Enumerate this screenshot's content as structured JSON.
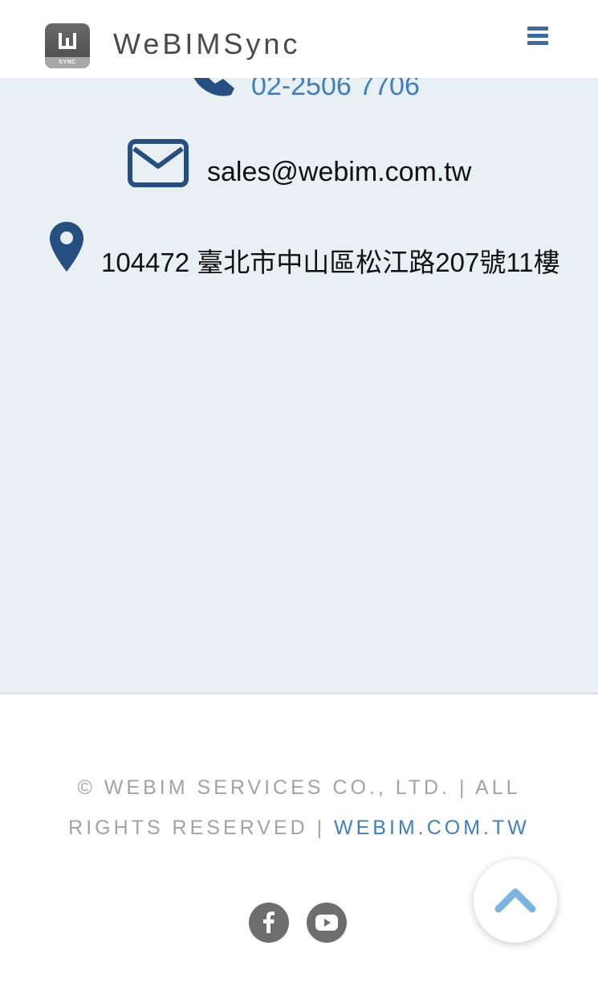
{
  "header": {
    "brand": "WeBIMSync",
    "logo_badge": "SYNC",
    "menu_icon": "hamburger-menu-icon"
  },
  "contact": {
    "phone": "02-2506 7706",
    "email": "sales@webim.com.tw",
    "address": "104472 臺北市中山區松江路207號11樓",
    "icons": [
      "phone-icon",
      "envelope-icon",
      "map-pin-icon"
    ]
  },
  "footer": {
    "copyright_prefix": "© WEBIM SERVICES CO., LTD. | ALL RIGHTS RESERVED | ",
    "link_text": "WEBIM.COM.TW",
    "social": [
      "facebook-icon",
      "youtube-icon"
    ]
  },
  "colors": {
    "accent": "#3d7fbf",
    "icon_dark": "#244f80",
    "section_bg": "#e9f0f4",
    "footer_text": "#a3a3a3"
  },
  "back_to_top_icon": "chevron-up-icon"
}
